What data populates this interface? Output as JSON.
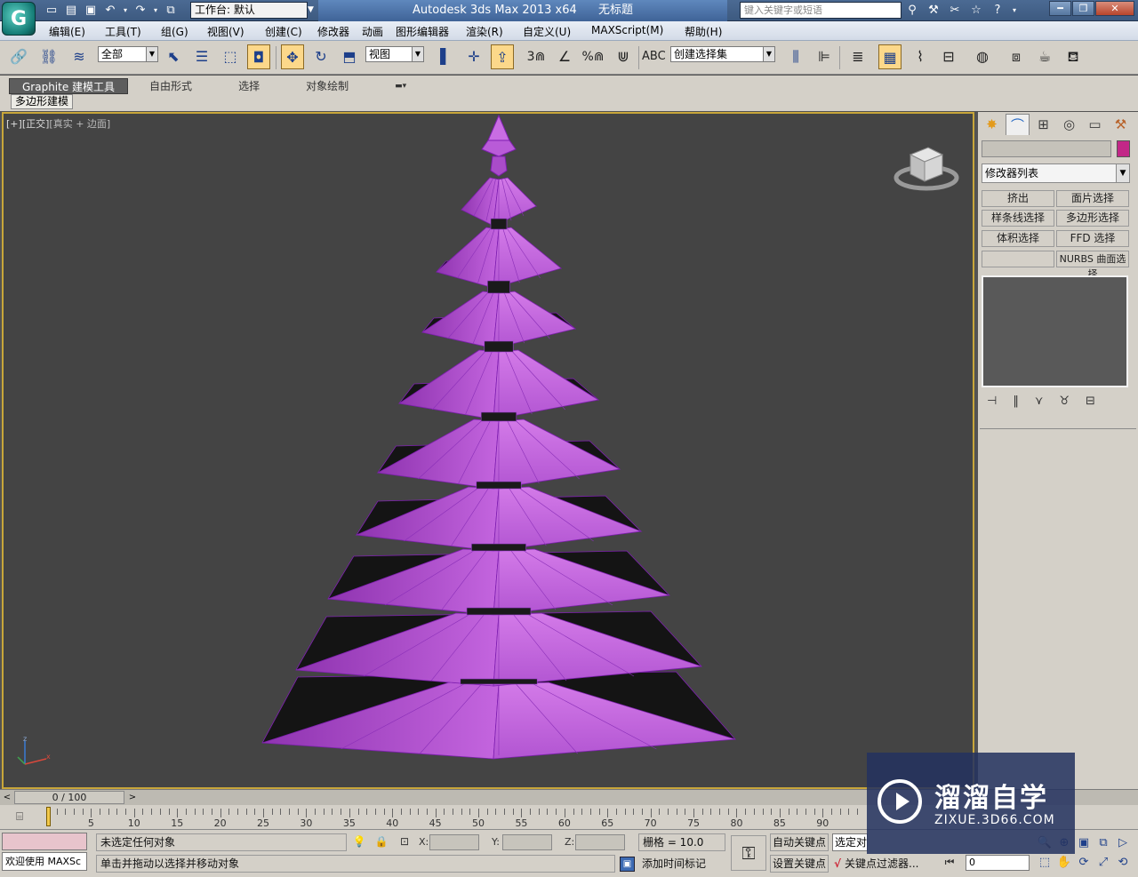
{
  "titlebar": {
    "workspace_label": "工作台: 默认",
    "app_name": "Autodesk 3ds Max  2013 x64",
    "doc_name": "无标题",
    "search_placeholder": "键入关键字或短语"
  },
  "menu": [
    "编辑(E)",
    "工具(T)",
    "组(G)",
    "视图(V)",
    "创建(C)",
    "修改器",
    "动画",
    "图形编辑器",
    "渲染(R)",
    "自定义(U)",
    "MAXScript(M)",
    "帮助(H)"
  ],
  "toolbar": {
    "selection_filter": "全部",
    "ref_coord": "视图",
    "named_selection": "创建选择集",
    "snap_labels": [
      "3",
      "%"
    ]
  },
  "ribbon": {
    "tabs": [
      "Graphite 建模工具",
      "自由形式",
      "选择",
      "对象绘制"
    ],
    "active_tab": "Graphite 建模工具",
    "panel_label": "多边形建模"
  },
  "viewport": {
    "label_plus": "[+]",
    "label_view": "[正交]",
    "label_shading": "[真实 + 边面]",
    "object_color": "#c55fe0"
  },
  "command_panel": {
    "modifier_list": "修改器列表",
    "object_color": "#c22787",
    "buttons": [
      "挤出",
      "面片选择",
      "样条线选择",
      "多边形选择",
      "体积选择",
      "FFD 选择",
      "",
      "NURBS 曲面选择"
    ]
  },
  "timeline": {
    "frame_display": "0 / 100",
    "ticks": [
      0,
      5,
      10,
      15,
      20,
      25,
      30,
      35,
      40,
      45,
      50,
      55,
      60,
      65,
      70,
      75,
      80,
      85,
      90
    ],
    "current_frame": 0
  },
  "status": {
    "listener": "欢迎使用 MAXSc",
    "selection_status": "未选定任何对象",
    "prompt": "单击并拖动以选择并移动对象",
    "x_label": "X:",
    "y_label": "Y:",
    "z_label": "Z:",
    "grid": "栅格 = 10.0",
    "add_time_tag": "添加时间标记",
    "auto_key": "自动关键点",
    "set_key": "设置关键点",
    "selected_dropdown": "选定对",
    "key_filter": "关键点过滤器...",
    "frame_value": "0"
  },
  "watermark": {
    "title": "溜溜自学",
    "url": "ZIXUE.3D66.COM"
  }
}
